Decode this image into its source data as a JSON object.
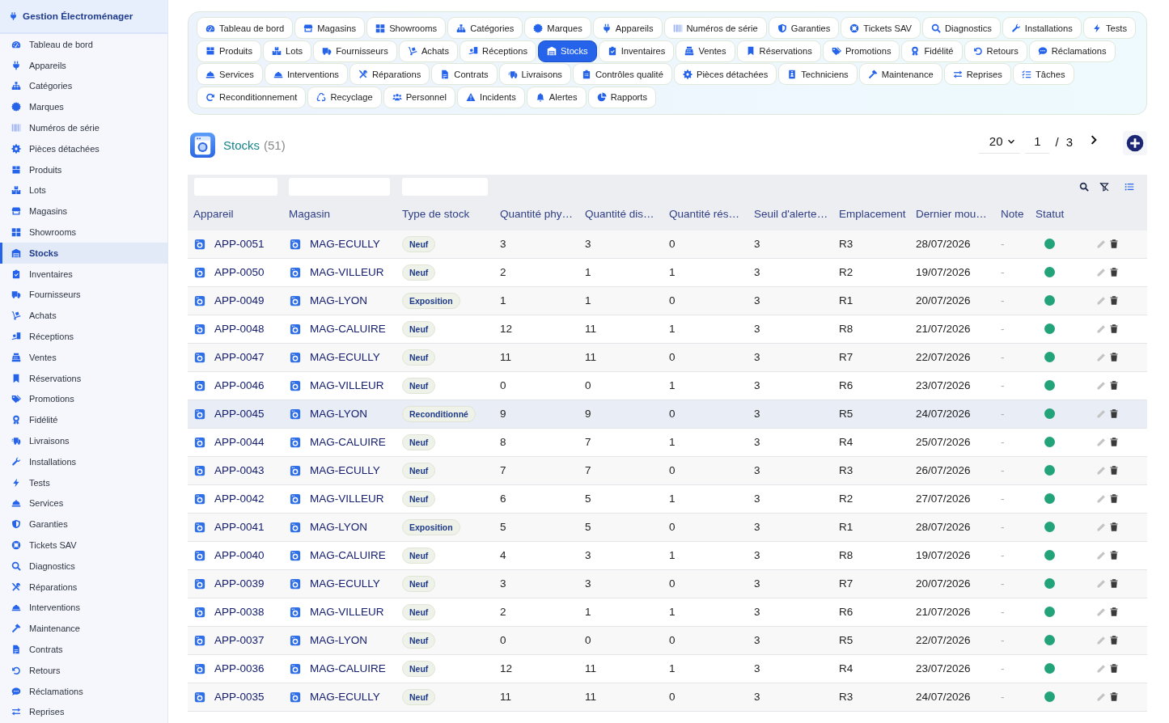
{
  "sidebar": {
    "title": "Gestion Électroménager",
    "items": [
      {
        "label": "Tableau de bord",
        "selected": false
      },
      {
        "label": "Appareils",
        "selected": false
      },
      {
        "label": "Catégories",
        "selected": false
      },
      {
        "label": "Marques",
        "selected": false
      },
      {
        "label": "Numéros de série",
        "selected": false
      },
      {
        "label": "Pièces détachées",
        "selected": false
      },
      {
        "label": "Produits",
        "selected": false
      },
      {
        "label": "Lots",
        "selected": false
      },
      {
        "label": "Magasins",
        "selected": false
      },
      {
        "label": "Showrooms",
        "selected": false
      },
      {
        "label": "Stocks",
        "selected": true
      },
      {
        "label": "Inventaires",
        "selected": false
      },
      {
        "label": "Fournisseurs",
        "selected": false
      },
      {
        "label": "Achats",
        "selected": false
      },
      {
        "label": "Réceptions",
        "selected": false
      },
      {
        "label": "Ventes",
        "selected": false
      },
      {
        "label": "Réservations",
        "selected": false
      },
      {
        "label": "Promotions",
        "selected": false
      },
      {
        "label": "Fidélité",
        "selected": false
      },
      {
        "label": "Livraisons",
        "selected": false
      },
      {
        "label": "Installations",
        "selected": false
      },
      {
        "label": "Tests",
        "selected": false
      },
      {
        "label": "Services",
        "selected": false
      },
      {
        "label": "Garanties",
        "selected": false
      },
      {
        "label": "Tickets SAV",
        "selected": false
      },
      {
        "label": "Diagnostics",
        "selected": false
      },
      {
        "label": "Réparations",
        "selected": false
      },
      {
        "label": "Interventions",
        "selected": false
      },
      {
        "label": "Maintenance",
        "selected": false
      },
      {
        "label": "Contrats",
        "selected": false
      },
      {
        "label": "Retours",
        "selected": false
      },
      {
        "label": "Réclamations",
        "selected": false
      },
      {
        "label": "Reprises",
        "selected": false
      }
    ]
  },
  "tabs": [
    {
      "label": "Tableau de bord",
      "selected": false
    },
    {
      "label": "Magasins",
      "selected": false
    },
    {
      "label": "Showrooms",
      "selected": false
    },
    {
      "label": "Catégories",
      "selected": false
    },
    {
      "label": "Marques",
      "selected": false
    },
    {
      "label": "Appareils",
      "selected": false
    },
    {
      "label": "Numéros de série",
      "selected": false
    },
    {
      "label": "Garanties",
      "selected": false
    },
    {
      "label": "Tickets SAV",
      "selected": false
    },
    {
      "label": "Diagnostics",
      "selected": false
    },
    {
      "label": "Installations",
      "selected": false
    },
    {
      "label": "Tests",
      "selected": false
    },
    {
      "label": "Produits",
      "selected": false
    },
    {
      "label": "Lots",
      "selected": false
    },
    {
      "label": "Fournisseurs",
      "selected": false
    },
    {
      "label": "Achats",
      "selected": false
    },
    {
      "label": "Réceptions",
      "selected": false
    },
    {
      "label": "Stocks",
      "selected": true
    },
    {
      "label": "Inventaires",
      "selected": false
    },
    {
      "label": "Ventes",
      "selected": false
    },
    {
      "label": "Réservations",
      "selected": false
    },
    {
      "label": "Promotions",
      "selected": false
    },
    {
      "label": "Fidélité",
      "selected": false
    },
    {
      "label": "Retours",
      "selected": false
    },
    {
      "label": "Réclamations",
      "selected": false
    },
    {
      "label": "Services",
      "selected": false
    },
    {
      "label": "Interventions",
      "selected": false
    },
    {
      "label": "Réparations",
      "selected": false
    },
    {
      "label": "Contrats",
      "selected": false
    },
    {
      "label": "Livraisons",
      "selected": false
    },
    {
      "label": "Contrôles qualité",
      "selected": false
    },
    {
      "label": "Pièces détachées",
      "selected": false
    },
    {
      "label": "Techniciens",
      "selected": false
    },
    {
      "label": "Maintenance",
      "selected": false
    },
    {
      "label": "Reprises",
      "selected": false
    },
    {
      "label": "Tâches",
      "selected": false
    },
    {
      "label": "Reconditionnement",
      "selected": false
    },
    {
      "label": "Recyclage",
      "selected": false
    },
    {
      "label": "Personnel",
      "selected": false
    },
    {
      "label": "Incidents",
      "selected": false
    },
    {
      "label": "Alertes",
      "selected": false
    },
    {
      "label": "Rapports",
      "selected": false
    }
  ],
  "page_header": {
    "title": "Stocks",
    "count": "(51)",
    "page_size": "20",
    "page": "1",
    "separator": "/",
    "page_count": "3"
  },
  "table": {
    "columns": [
      "Appareil",
      "Magasin",
      "Type de stock",
      "Quantité phy…",
      "Quantité dis…",
      "Quantité rés…",
      "Seuil d'alerte…",
      "Emplacement",
      "Dernier mou…",
      "Note",
      "Statut"
    ],
    "rows": [
      {
        "appareil": "APP-0051",
        "magasin": "MAG-ECULLY",
        "type_de_stock": "Neuf",
        "quantite_phy": "3",
        "quantite_dis": "3",
        "quantite_res": "0",
        "seuil_alerte": "3",
        "emplacement": "R3",
        "dernier_mou": "28/07/2026",
        "note": "-",
        "status_ok": true,
        "selected": false
      },
      {
        "appareil": "APP-0050",
        "magasin": "MAG-VILLEUR",
        "type_de_stock": "Neuf",
        "quantite_phy": "2",
        "quantite_dis": "1",
        "quantite_res": "1",
        "seuil_alerte": "3",
        "emplacement": "R2",
        "dernier_mou": "19/07/2026",
        "note": "-",
        "status_ok": true,
        "selected": false
      },
      {
        "appareil": "APP-0049",
        "magasin": "MAG-LYON",
        "type_de_stock": "Exposition",
        "quantite_phy": "1",
        "quantite_dis": "1",
        "quantite_res": "0",
        "seuil_alerte": "3",
        "emplacement": "R1",
        "dernier_mou": "20/07/2026",
        "note": "-",
        "status_ok": true,
        "selected": false
      },
      {
        "appareil": "APP-0048",
        "magasin": "MAG-CALUIRE",
        "type_de_stock": "Neuf",
        "quantite_phy": "12",
        "quantite_dis": "11",
        "quantite_res": "1",
        "seuil_alerte": "3",
        "emplacement": "R8",
        "dernier_mou": "21/07/2026",
        "note": "-",
        "status_ok": true,
        "selected": false
      },
      {
        "appareil": "APP-0047",
        "magasin": "MAG-ECULLY",
        "type_de_stock": "Neuf",
        "quantite_phy": "11",
        "quantite_dis": "11",
        "quantite_res": "0",
        "seuil_alerte": "3",
        "emplacement": "R7",
        "dernier_mou": "22/07/2026",
        "note": "-",
        "status_ok": true,
        "selected": false
      },
      {
        "appareil": "APP-0046",
        "magasin": "MAG-VILLEUR",
        "type_de_stock": "Neuf",
        "quantite_phy": "0",
        "quantite_dis": "0",
        "quantite_res": "1",
        "seuil_alerte": "3",
        "emplacement": "R6",
        "dernier_mou": "23/07/2026",
        "note": "-",
        "status_ok": true,
        "selected": false
      },
      {
        "appareil": "APP-0045",
        "magasin": "MAG-LYON",
        "type_de_stock": "Reconditionné",
        "quantite_phy": "9",
        "quantite_dis": "9",
        "quantite_res": "0",
        "seuil_alerte": "3",
        "emplacement": "R5",
        "dernier_mou": "24/07/2026",
        "note": "-",
        "status_ok": true,
        "selected": true
      },
      {
        "appareil": "APP-0044",
        "magasin": "MAG-CALUIRE",
        "type_de_stock": "Neuf",
        "quantite_phy": "8",
        "quantite_dis": "7",
        "quantite_res": "1",
        "seuil_alerte": "3",
        "emplacement": "R4",
        "dernier_mou": "25/07/2026",
        "note": "-",
        "status_ok": true,
        "selected": false
      },
      {
        "appareil": "APP-0043",
        "magasin": "MAG-ECULLY",
        "type_de_stock": "Neuf",
        "quantite_phy": "7",
        "quantite_dis": "7",
        "quantite_res": "0",
        "seuil_alerte": "3",
        "emplacement": "R3",
        "dernier_mou": "26/07/2026",
        "note": "-",
        "status_ok": true,
        "selected": false
      },
      {
        "appareil": "APP-0042",
        "magasin": "MAG-VILLEUR",
        "type_de_stock": "Neuf",
        "quantite_phy": "6",
        "quantite_dis": "5",
        "quantite_res": "1",
        "seuil_alerte": "3",
        "emplacement": "R2",
        "dernier_mou": "27/07/2026",
        "note": "-",
        "status_ok": true,
        "selected": false
      },
      {
        "appareil": "APP-0041",
        "magasin": "MAG-LYON",
        "type_de_stock": "Exposition",
        "quantite_phy": "5",
        "quantite_dis": "5",
        "quantite_res": "0",
        "seuil_alerte": "3",
        "emplacement": "R1",
        "dernier_mou": "28/07/2026",
        "note": "-",
        "status_ok": true,
        "selected": false
      },
      {
        "appareil": "APP-0040",
        "magasin": "MAG-CALUIRE",
        "type_de_stock": "Neuf",
        "quantite_phy": "4",
        "quantite_dis": "3",
        "quantite_res": "1",
        "seuil_alerte": "3",
        "emplacement": "R8",
        "dernier_mou": "19/07/2026",
        "note": "-",
        "status_ok": true,
        "selected": false
      },
      {
        "appareil": "APP-0039",
        "magasin": "MAG-ECULLY",
        "type_de_stock": "Neuf",
        "quantite_phy": "3",
        "quantite_dis": "3",
        "quantite_res": "0",
        "seuil_alerte": "3",
        "emplacement": "R7",
        "dernier_mou": "20/07/2026",
        "note": "-",
        "status_ok": true,
        "selected": false
      },
      {
        "appareil": "APP-0038",
        "magasin": "MAG-VILLEUR",
        "type_de_stock": "Neuf",
        "quantite_phy": "2",
        "quantite_dis": "1",
        "quantite_res": "1",
        "seuil_alerte": "3",
        "emplacement": "R6",
        "dernier_mou": "21/07/2026",
        "note": "-",
        "status_ok": true,
        "selected": false
      },
      {
        "appareil": "APP-0037",
        "magasin": "MAG-LYON",
        "type_de_stock": "Neuf",
        "quantite_phy": "0",
        "quantite_dis": "0",
        "quantite_res": "0",
        "seuil_alerte": "3",
        "emplacement": "R5",
        "dernier_mou": "22/07/2026",
        "note": "-",
        "status_ok": true,
        "selected": false
      },
      {
        "appareil": "APP-0036",
        "magasin": "MAG-CALUIRE",
        "type_de_stock": "Neuf",
        "quantite_phy": "12",
        "quantite_dis": "11",
        "quantite_res": "1",
        "seuil_alerte": "3",
        "emplacement": "R4",
        "dernier_mou": "23/07/2026",
        "note": "-",
        "status_ok": true,
        "selected": false
      },
      {
        "appareil": "APP-0035",
        "magasin": "MAG-ECULLY",
        "type_de_stock": "Neuf",
        "quantite_phy": "11",
        "quantite_dis": "11",
        "quantite_res": "0",
        "seuil_alerte": "3",
        "emplacement": "R3",
        "dernier_mou": "24/07/2026",
        "note": "-",
        "status_ok": true,
        "selected": false
      }
    ]
  }
}
